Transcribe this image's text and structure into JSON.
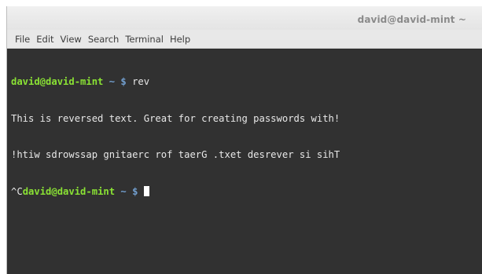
{
  "window": {
    "title": "david@david-mint ~"
  },
  "menu": {
    "items": [
      "File",
      "Edit",
      "View",
      "Search",
      "Terminal",
      "Help"
    ]
  },
  "terminal": {
    "line1": {
      "user_host": "david@david-mint",
      "path": " ~ $ ",
      "command": "rev"
    },
    "line2": "This is reversed text. Great for creating passwords with!",
    "line3": "!htiw sdrowssap gnitaerc rof taerG .txet desrever si sihT",
    "line4": {
      "interrupt": "^C",
      "user_host": "david@david-mint",
      "path": " ~ $ "
    }
  },
  "colors": {
    "prompt_user": "#8ae234",
    "prompt_path": "#729fcf",
    "background": "#313131",
    "text": "#e8e8e8"
  }
}
